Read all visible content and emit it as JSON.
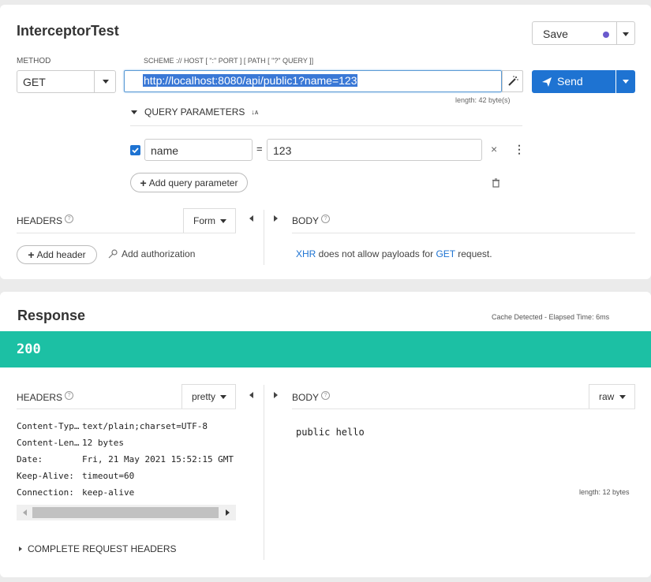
{
  "request": {
    "title": "InterceptorTest",
    "save_label": "Save",
    "method_label": "METHOD",
    "method_value": "GET",
    "url_hint": "SCHEME :// HOST [ \":\" PORT ] [ PATH [ \"?\" QUERY ]]",
    "url_value": "http://localhost:8080/api/public1?name=123",
    "send_label": "Send",
    "length_info": "length: 42 byte(s)",
    "query_params_title": "QUERY PARAMETERS",
    "params": [
      {
        "name": "name",
        "equals": "=",
        "value": "123",
        "checked": true
      }
    ],
    "add_param_label": "Add query parameter",
    "headers_title": "HEADERS",
    "headers_mode": "Form",
    "body_title": "BODY",
    "add_header_label": "Add header",
    "add_auth_label": "Add authorization",
    "body_msg_xhr": "XHR",
    "body_msg_mid": " does not allow payloads for ",
    "body_msg_get": "GET",
    "body_msg_end": " request."
  },
  "response": {
    "title": "Response",
    "cache_info": "Cache Detected - Elapsed Time: 6ms",
    "status": "200",
    "headers_title": "HEADERS",
    "headers_mode": "pretty",
    "body_title": "BODY",
    "body_mode": "raw",
    "headers": [
      {
        "key": "Content-Typ…",
        "value": "text/plain;charset=UTF-8"
      },
      {
        "key": "Content-Len…",
        "value": "12 bytes"
      },
      {
        "key": "Date:",
        "value": "Fri, 21 May 2021 15:52:15 GMT"
      },
      {
        "key": "Keep-Alive:",
        "value": "timeout=60"
      },
      {
        "key": "Connection:",
        "value": "keep-alive"
      }
    ],
    "body_text": "public hello",
    "length_info": "length: 12 bytes",
    "complete_headers_label": "COMPLETE REQUEST HEADERS"
  },
  "colors": {
    "accent": "#1e73d2",
    "status_ok": "#1cc0a4",
    "save_dot": "#6a5acd"
  }
}
